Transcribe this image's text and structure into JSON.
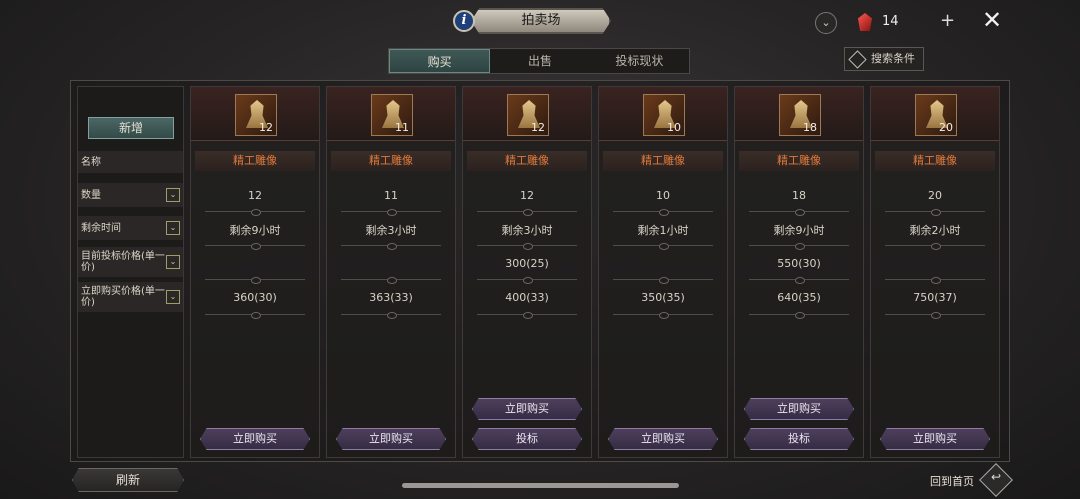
{
  "header": {
    "info_glyph": "i",
    "title": "拍卖场",
    "download_glyph": "⌄",
    "currency_count": "14",
    "plus_glyph": "+",
    "close_glyph": "✕"
  },
  "tabs": [
    {
      "label": "购买",
      "active": true
    },
    {
      "label": "出售",
      "active": false
    },
    {
      "label": "投标现状",
      "active": false
    }
  ],
  "search_label": "搜索条件",
  "sidebar": {
    "new_label": "新增",
    "name_label": "名称",
    "filters": [
      {
        "label": "数量"
      },
      {
        "label": "剩余时间"
      },
      {
        "label": "目前投标价格(单一价)"
      },
      {
        "label": "立即购买价格(单一价)"
      }
    ],
    "chevron_glyph": "⌄"
  },
  "items": [
    {
      "qty": "12",
      "name": "精工雕像",
      "quantity": "12",
      "time_left": "剩余9小时",
      "current_bid": "",
      "buyout": "360(30)",
      "buttons": [
        "立即购买"
      ]
    },
    {
      "qty": "11",
      "name": "精工雕像",
      "quantity": "11",
      "time_left": "剩余3小时",
      "current_bid": "",
      "buyout": "363(33)",
      "buttons": [
        "立即购买"
      ]
    },
    {
      "qty": "12",
      "name": "精工雕像",
      "quantity": "12",
      "time_left": "剩余3小时",
      "current_bid": "300(25)",
      "buyout": "400(33)",
      "buttons": [
        "立即购买",
        "投标"
      ]
    },
    {
      "qty": "10",
      "name": "精工雕像",
      "quantity": "10",
      "time_left": "剩余1小时",
      "current_bid": "",
      "buyout": "350(35)",
      "buttons": [
        "立即购买"
      ]
    },
    {
      "qty": "18",
      "name": "精工雕像",
      "quantity": "18",
      "time_left": "剩余9小时",
      "current_bid": "550(30)",
      "buyout": "640(35)",
      "buttons": [
        "立即购买",
        "投标"
      ]
    },
    {
      "qty": "20",
      "name": "精工雕像",
      "quantity": "20",
      "time_left": "剩余2小时",
      "current_bid": "",
      "buyout": "750(37)",
      "buttons": [
        "立即购买"
      ]
    }
  ],
  "footer": {
    "refresh_label": "刷新",
    "home_label": "回到首页",
    "home_glyph": "↩"
  },
  "colors": {
    "accent_teal": "#3f5856",
    "item_name_orange": "#e07a3a",
    "button_purple": "#4d3f5c",
    "currency_red": "#c0302a"
  }
}
